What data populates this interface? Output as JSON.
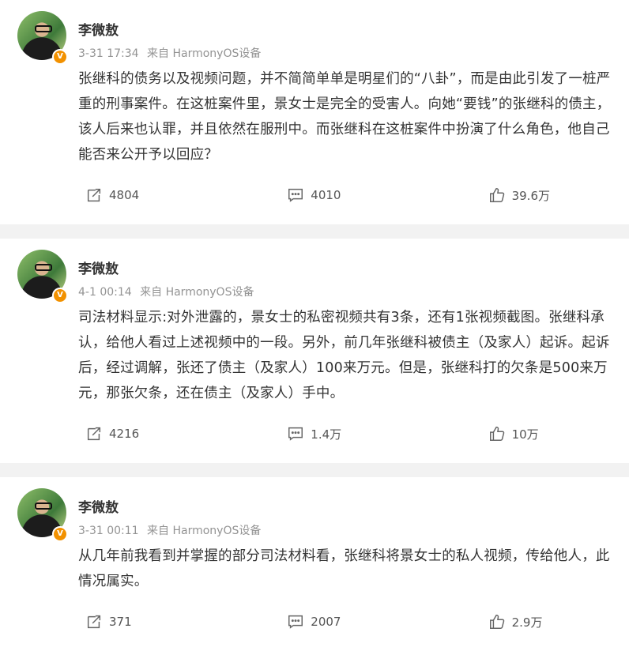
{
  "posts": [
    {
      "author": "李微敖",
      "time": "3-31 17:34",
      "source": "来自 HarmonyOS设备",
      "text": "张继科的债务以及视频问题，并不简简单单是明星们的“八卦”，而是由此引发了一桩严重的刑事案件。在这桩案件里，景女士是完全的受害人。向她“要钱”的张继科的债主，该人后来也认罪，并且依然在服刑中。而张继科在这桩案件中扮演了什么角色，他自己能否来公开予以回应？",
      "reposts": "4804",
      "comments": "4010",
      "likes": "39.6万"
    },
    {
      "author": "李微敖",
      "time": "4-1 00:14",
      "source": "来自 HarmonyOS设备",
      "text": "司法材料显示:对外泄露的，景女士的私密视频共有3条，还有1张视频截图。张继科承认，给他人看过上述视频中的一段。另外，前几年张继科被债主（及家人）起诉。起诉后，经过调解，张还了债主（及家人）100来万元。但是，张继科打的欠条是500来万元，那张欠条，还在债主（及家人）手中。",
      "reposts": "4216",
      "comments": "1.4万",
      "likes": "10万"
    },
    {
      "author": "李微敖",
      "time": "3-31 00:11",
      "source": "来自 HarmonyOS设备",
      "text": "从几年前我看到并掌握的部分司法材料看，张继科将景女士的私人视频，传给他人，此情况属实。",
      "reposts": "371",
      "comments": "2007",
      "likes": "2.9万"
    }
  ],
  "icons": {
    "repost": "repost-icon",
    "comment": "comment-icon",
    "like": "like-icon",
    "verified": "verified-badge-icon"
  },
  "colors": {
    "text": "#333333",
    "meta": "#939393",
    "badge": "#f29100",
    "background": "#f2f2f2"
  }
}
